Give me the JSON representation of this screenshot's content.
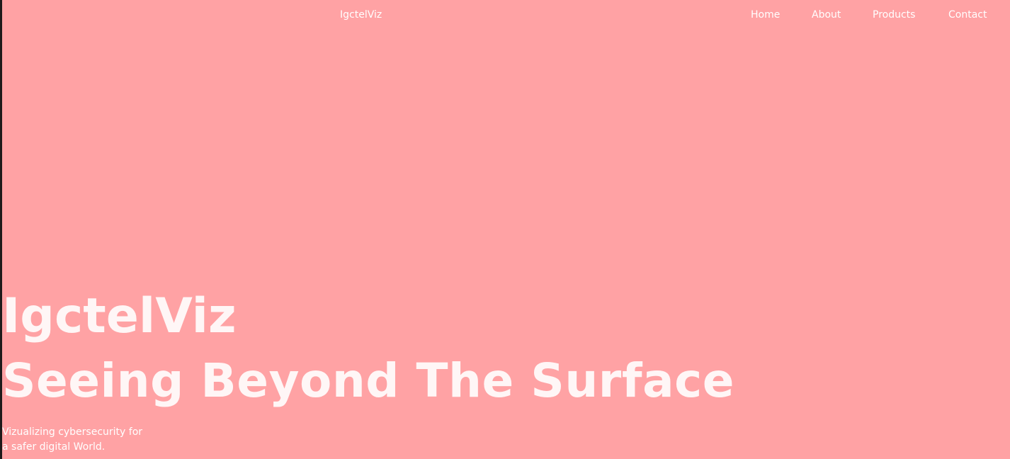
{
  "header": {
    "brand": "IgctelViz",
    "nav": {
      "home": "Home",
      "about": "About",
      "products": "Products",
      "contact": "Contact"
    }
  },
  "hero": {
    "title": "IgctelViz",
    "subtitle": "Seeing Beyond The Surface",
    "tagline_line1": "Vizualizing cybersecurity for",
    "tagline_line2": "a safer digital World."
  },
  "colors": {
    "background": "#ffa2a4",
    "text": "#ffffff"
  }
}
